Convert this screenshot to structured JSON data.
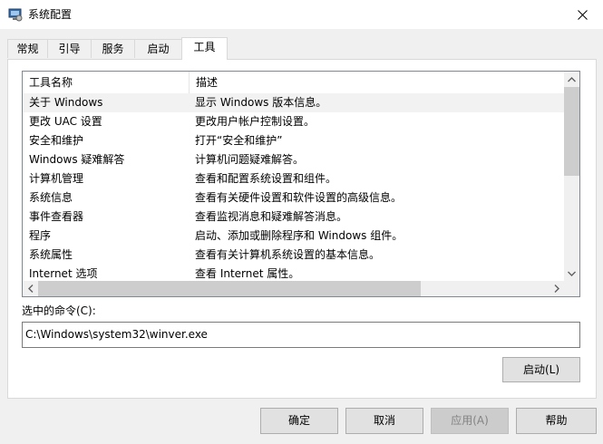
{
  "window": {
    "title": "系统配置"
  },
  "tabs": [
    {
      "label": "常规"
    },
    {
      "label": "引导"
    },
    {
      "label": "服务"
    },
    {
      "label": "启动"
    },
    {
      "label": "工具",
      "active": true
    }
  ],
  "tools": {
    "columns": [
      "工具名称",
      "描述"
    ],
    "rows": [
      {
        "name": "关于 Windows",
        "desc": "显示 Windows 版本信息。",
        "selected": true
      },
      {
        "name": "更改 UAC 设置",
        "desc": "更改用户帐户控制设置。"
      },
      {
        "name": "安全和维护",
        "desc": "打开“安全和维护”"
      },
      {
        "name": "Windows 疑难解答",
        "desc": "计算机问题疑难解答。"
      },
      {
        "name": "计算机管理",
        "desc": "查看和配置系统设置和组件。"
      },
      {
        "name": "系统信息",
        "desc": "查看有关硬件设置和软件设置的高级信息。"
      },
      {
        "name": "事件查看器",
        "desc": "查看监视消息和疑难解答消息。"
      },
      {
        "name": "程序",
        "desc": "启动、添加或删除程序和 Windows 组件。"
      },
      {
        "name": "系统属性",
        "desc": "查看有关计算机系统设置的基本信息。"
      },
      {
        "name": "Internet 选项",
        "desc": "查看 Internet 属性。"
      }
    ]
  },
  "selected_command": {
    "label": "选中的命令(C):",
    "value": "C:\\Windows\\system32\\winver.exe"
  },
  "launch_button": "启动(L)",
  "footer": {
    "ok": "确定",
    "cancel": "取消",
    "apply": "应用(A)",
    "help": "帮助"
  },
  "colors": {
    "selected_row": "#f2f2f2",
    "button": "#e1e1e1",
    "disabled_button": "#cccccc"
  },
  "icons": {
    "app": "msconfig-icon",
    "close": "close-icon"
  }
}
